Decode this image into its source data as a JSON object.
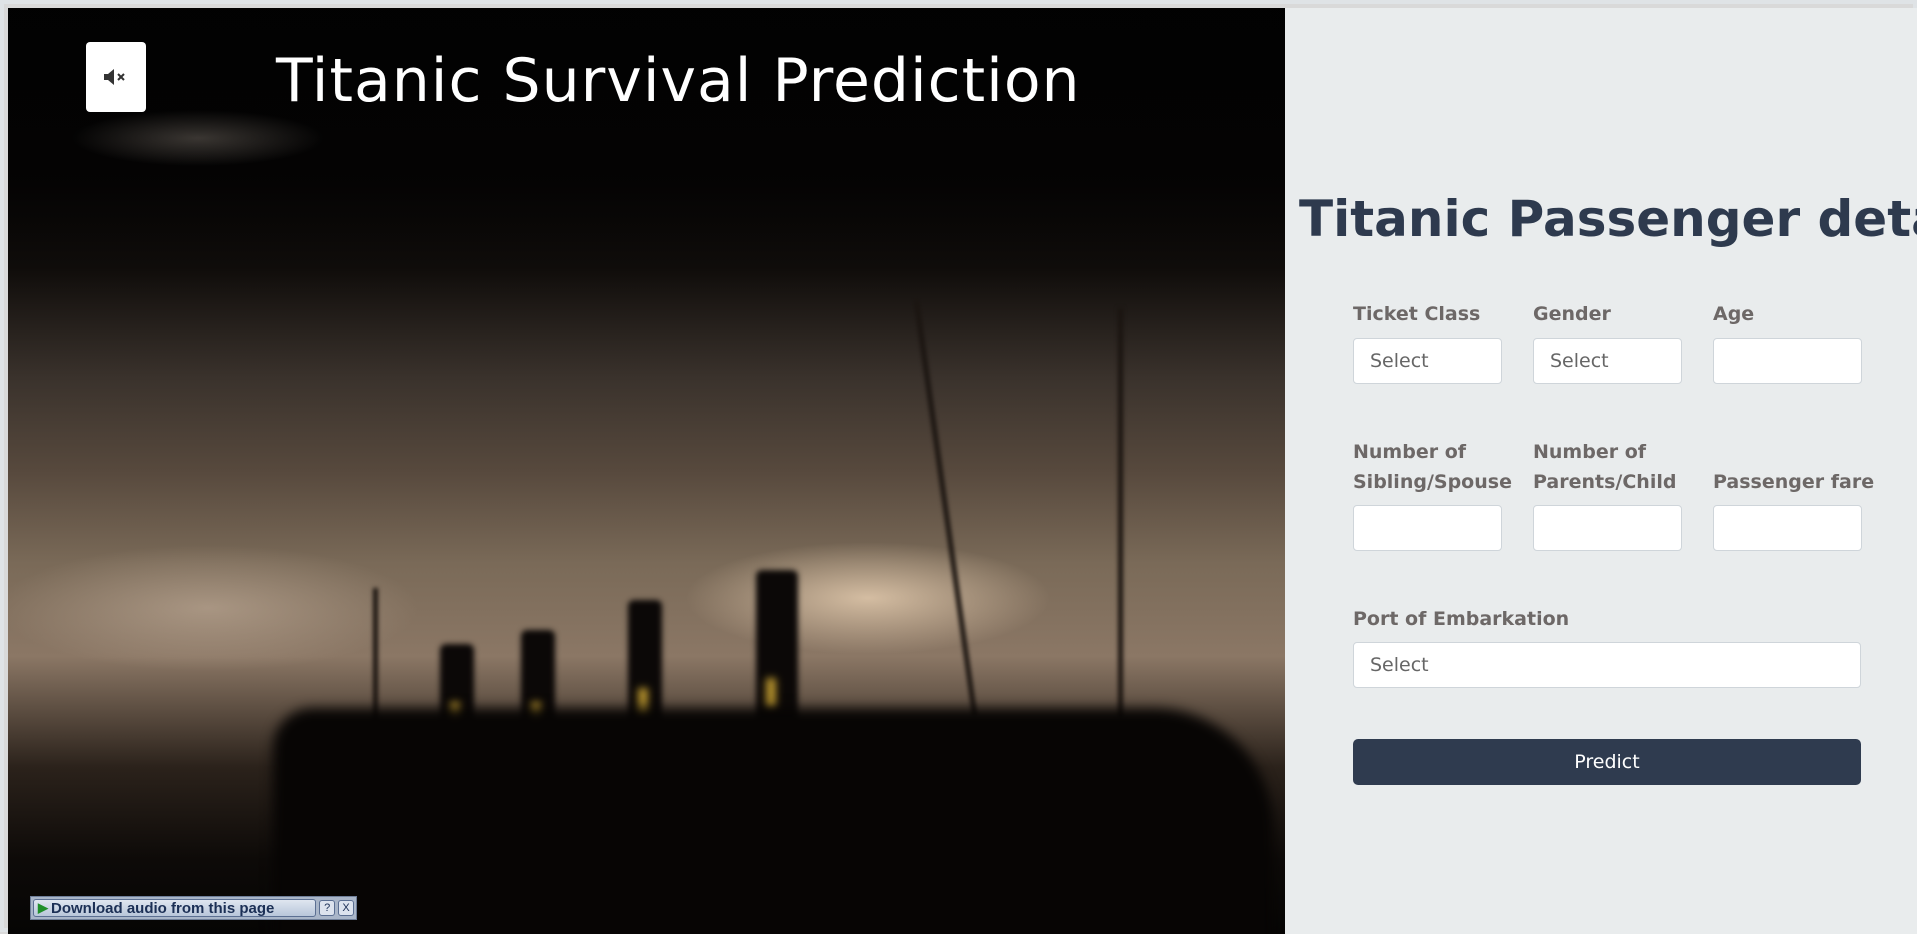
{
  "video": {
    "title": "Titanic Survival Prediction",
    "mute_icon": "speaker-muted-icon",
    "mute_icon_glyph": "🔇",
    "mute_icon_text": "◀×"
  },
  "download_bar": {
    "label": "Download audio from this page",
    "help_label": "?",
    "close_label": "X"
  },
  "form": {
    "title": "Titanic Passenger details",
    "fields": {
      "ticket_class": {
        "label": "Ticket Class",
        "placeholder": "Select"
      },
      "gender": {
        "label": "Gender",
        "placeholder": "Select"
      },
      "age": {
        "label": "Age",
        "value": ""
      },
      "siblings": {
        "label": "Number of Sibling/Spouse",
        "value": ""
      },
      "parents": {
        "label": "Number of Parents/Child",
        "value": ""
      },
      "fare": {
        "label": "Passenger fare",
        "value": ""
      },
      "port": {
        "label": "Port of Embarkation",
        "placeholder": "Select"
      }
    },
    "predict_label": "Predict"
  },
  "colors": {
    "form_background": "#e9eced",
    "title_color": "#2e3a4e",
    "button_color": "#2f3b4f",
    "label_color": "#6d6867"
  }
}
